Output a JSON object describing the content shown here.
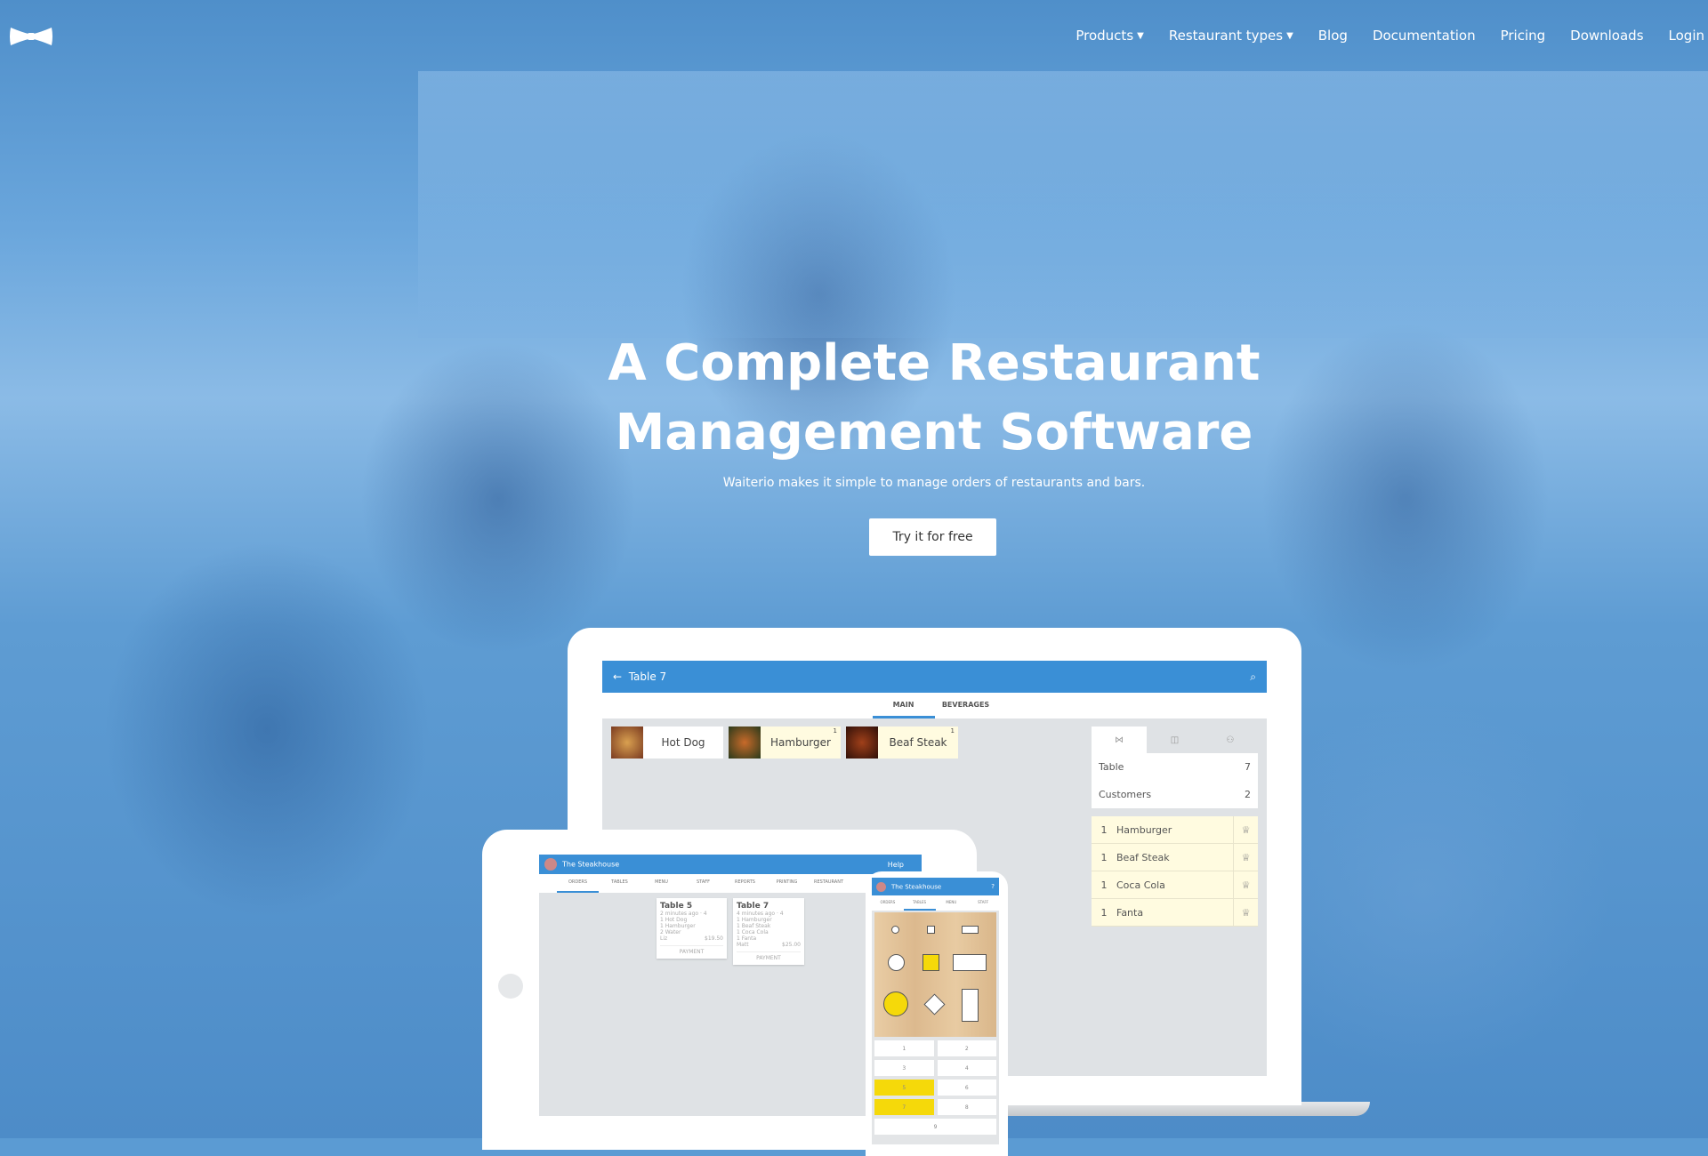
{
  "brand": {
    "logo": "bow-tie-logo"
  },
  "nav": [
    {
      "label": "Products",
      "dropdown": true
    },
    {
      "label": "Restaurant types",
      "dropdown": true
    },
    {
      "label": "Blog"
    },
    {
      "label": "Documentation"
    },
    {
      "label": "Pricing"
    },
    {
      "label": "Downloads"
    },
    {
      "label": "Login"
    }
  ],
  "hero": {
    "title_line1": "A Complete Restaurant",
    "title_line2": "Management Software",
    "subtitle": "Waiterio makes it simple to manage orders of restaurants and bars.",
    "cta": "Try it for free"
  },
  "laptop": {
    "header_title": "Table 7",
    "tabs": [
      "MAIN",
      "BEVERAGES"
    ],
    "menu_items": [
      {
        "name": "Hot Dog",
        "count": ""
      },
      {
        "name": "Hamburger",
        "count": "1"
      },
      {
        "name": "Beaf Steak",
        "count": "1"
      }
    ],
    "info": [
      {
        "label": "Table",
        "value": "7"
      },
      {
        "label": "Customers",
        "value": "2"
      }
    ],
    "orders": [
      {
        "qty": "1",
        "name": "Hamburger"
      },
      {
        "qty": "1",
        "name": "Beaf Steak"
      },
      {
        "qty": "1",
        "name": "Coca Cola"
      },
      {
        "qty": "1",
        "name": "Fanta"
      }
    ]
  },
  "tablet": {
    "restaurant": "The Steakhouse",
    "help": "Help",
    "tabs": [
      "ORDERS",
      "TABLES",
      "MENU",
      "STAFF",
      "REPORTS",
      "PRINTING",
      "RESTAURANT"
    ],
    "cards": [
      {
        "title": "Table 5",
        "meta": "2 minutes ago · 4",
        "lines": [
          "1 Hot Dog",
          "1 Hamburger",
          "2 Water"
        ],
        "footer_left": "Liz",
        "total": "$19.50",
        "action": "PAYMENT"
      },
      {
        "title": "Table 7",
        "meta": "4 minutes ago · 4",
        "lines": [
          "1 Hamburger",
          "1 Beaf Steak",
          "1 Coca Cola",
          "1 Fanta"
        ],
        "footer_left": "Matt",
        "total": "$25.00",
        "action": "PAYMENT"
      }
    ]
  },
  "phone": {
    "restaurant": "The Steakhouse",
    "help": "?",
    "tabs": [
      "ORDERS",
      "TABLES",
      "MENU",
      "STAFF"
    ],
    "tables": [
      "1",
      "2",
      "3",
      "4",
      "5",
      "6",
      "7",
      "8",
      "9"
    ],
    "occupied": [
      "5",
      "7"
    ]
  },
  "colors": {
    "accent": "#3a8fd6",
    "occupied": "#f5d90a",
    "background": "#5b9bd3"
  }
}
